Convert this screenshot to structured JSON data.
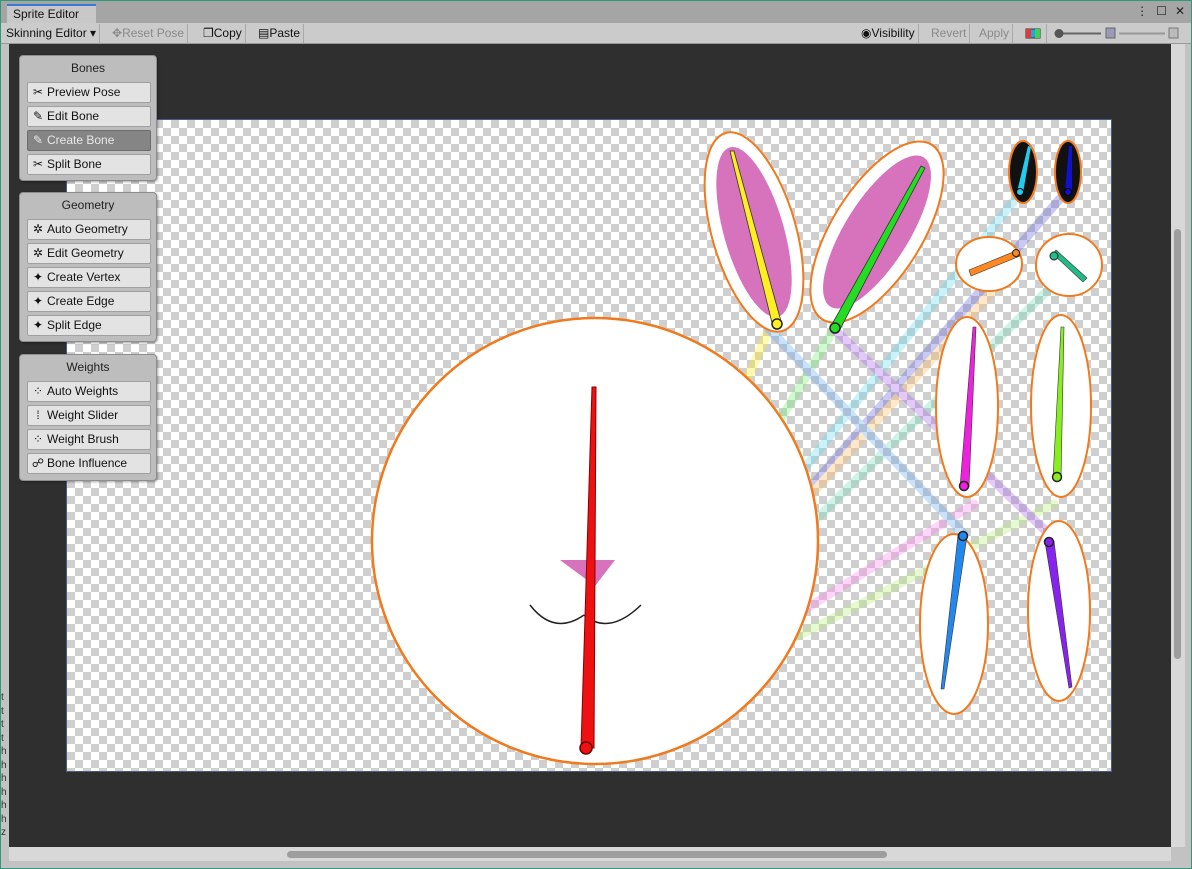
{
  "window": {
    "tab_title": "Sprite Editor",
    "controls": {
      "more": "⋮",
      "maximize": "☐",
      "close": "✕"
    }
  },
  "toolbar": {
    "mode_dropdown": "Skinning Editor ▾",
    "reset_pose": "Reset Pose",
    "copy": "Copy",
    "paste": "Paste",
    "visibility": "Visibility",
    "revert": "Revert",
    "apply": "Apply"
  },
  "panels": {
    "bones": {
      "title": "Bones",
      "items": [
        {
          "label": "Preview Pose",
          "icon": "preview-pose-icon",
          "glyph": "✂"
        },
        {
          "label": "Edit Bone",
          "icon": "edit-bone-icon",
          "glyph": "✎"
        },
        {
          "label": "Create Bone",
          "icon": "create-bone-icon",
          "glyph": "✎",
          "active": true
        },
        {
          "label": "Split Bone",
          "icon": "split-bone-icon",
          "glyph": "✂"
        }
      ]
    },
    "geometry": {
      "title": "Geometry",
      "items": [
        {
          "label": "Auto Geometry",
          "icon": "auto-geometry-icon",
          "glyph": "✲"
        },
        {
          "label": "Edit Geometry",
          "icon": "edit-geometry-icon",
          "glyph": "✲"
        },
        {
          "label": "Create Vertex",
          "icon": "create-vertex-icon",
          "glyph": "✦"
        },
        {
          "label": "Create Edge",
          "icon": "create-edge-icon",
          "glyph": "✦"
        },
        {
          "label": "Split Edge",
          "icon": "split-edge-icon",
          "glyph": "✦"
        }
      ]
    },
    "weights": {
      "title": "Weights",
      "items": [
        {
          "label": "Auto Weights",
          "icon": "auto-weights-icon",
          "glyph": "⁘"
        },
        {
          "label": "Weight Slider",
          "icon": "weight-slider-icon",
          "glyph": "⁞"
        },
        {
          "label": "Weight Brush",
          "icon": "weight-brush-icon",
          "glyph": "⁘"
        },
        {
          "label": "Bone Influence",
          "icon": "bone-influence-icon",
          "glyph": "☍"
        }
      ]
    }
  },
  "colors": {
    "outline": "#f07a1e",
    "mesh_fill": "#cf5bb0",
    "bones": {
      "head": "#ee1111",
      "ear_left": "#ffee22",
      "ear_right": "#22dd22",
      "eye_left": "#22ccee",
      "eye_right": "#1111cc",
      "cheek_left": "#ff8822",
      "cheek_right": "#22bb88",
      "arm_left": "#ee22dd",
      "arm_right": "#88ee22",
      "leg_left": "#2288ee",
      "leg_right": "#8822ee"
    }
  },
  "left_strip": [
    "t",
    "t",
    "t",
    "t",
    "h",
    "h",
    "h",
    "h",
    "h",
    "h",
    "z"
  ]
}
